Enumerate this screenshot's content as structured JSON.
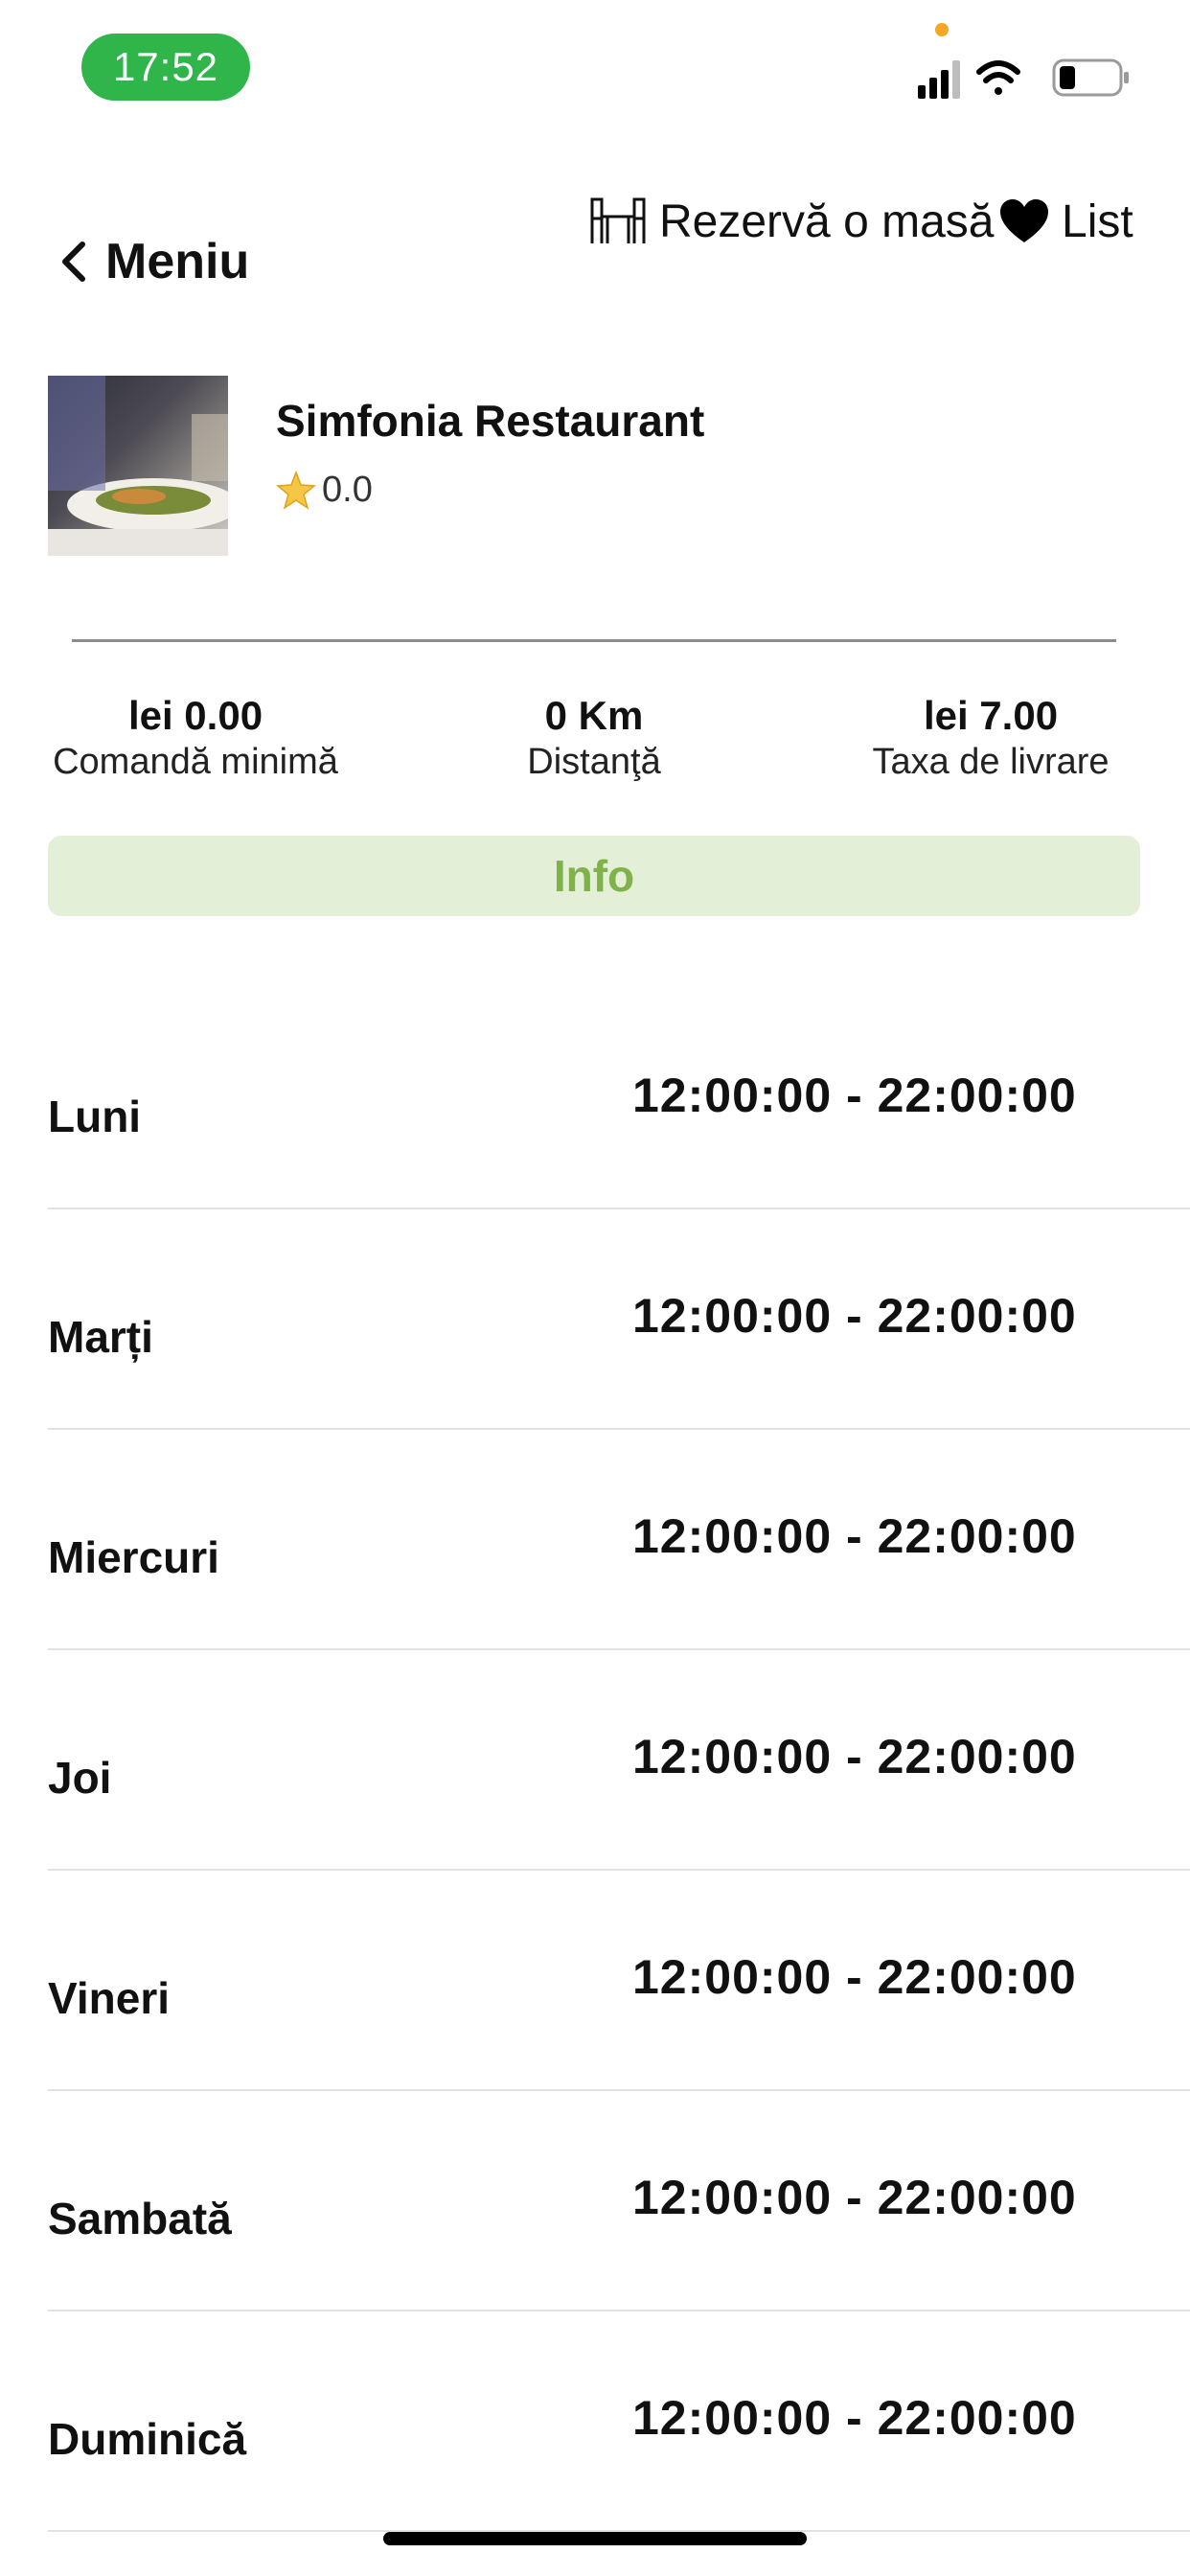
{
  "status_bar": {
    "time": "17:52"
  },
  "header": {
    "back_label": "Meniu",
    "reserve_label": "Rezervă o masă",
    "list_label": "List"
  },
  "restaurant": {
    "name": "Simfonia Restaurant",
    "rating": "0.0"
  },
  "stats": [
    {
      "value": "lei 0.00",
      "label": "Comandă minimă"
    },
    {
      "value": "0 Km",
      "label": "Distanţă"
    },
    {
      "value": "lei 7.00",
      "label": "Taxa de livrare"
    }
  ],
  "info_tab": {
    "label": "Info"
  },
  "hours": [
    {
      "day": "Luni",
      "time": "12:00:00 - 22:00:00"
    },
    {
      "day": "Marți",
      "time": "12:00:00 - 22:00:00"
    },
    {
      "day": "Miercuri",
      "time": "12:00:00 - 22:00:00"
    },
    {
      "day": "Joi",
      "time": "12:00:00 - 22:00:00"
    },
    {
      "day": "Vineri",
      "time": "12:00:00 - 22:00:00"
    },
    {
      "day": "Sambată",
      "time": "12:00:00 - 22:00:00"
    },
    {
      "day": "Duminică",
      "time": "12:00:00 - 22:00:00"
    }
  ],
  "colors": {
    "status_pill": "#2fb54a",
    "info_tab_bg": "#e3efd7",
    "info_tab_text": "#7fb24a"
  },
  "icons": [
    "chevron-left-icon",
    "dining-table-icon",
    "heart-icon",
    "star-icon",
    "signal-icon",
    "wifi-icon",
    "battery-icon"
  ]
}
